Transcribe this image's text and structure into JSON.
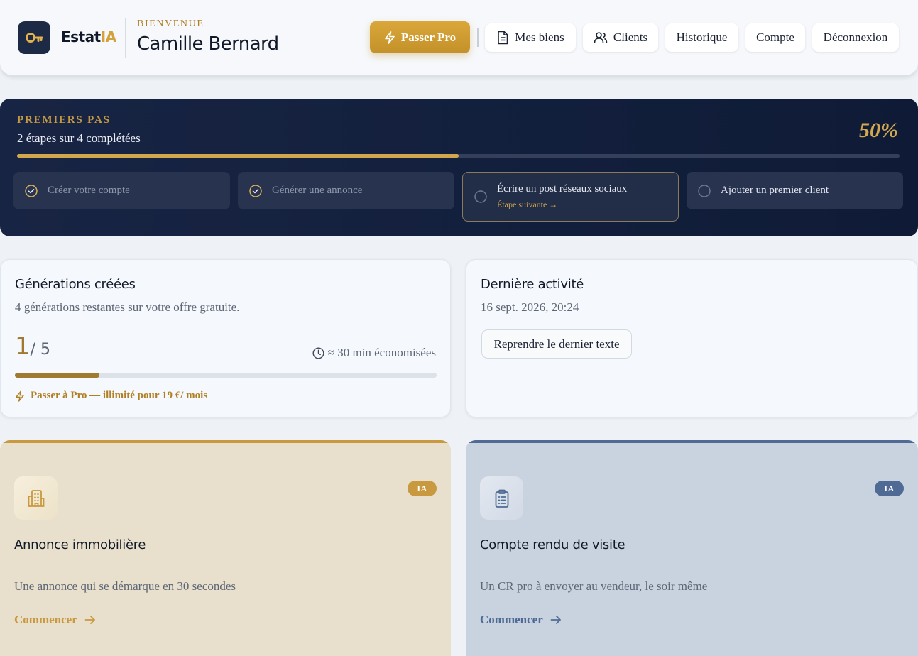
{
  "header": {
    "brand_main": "Estat",
    "brand_accent": "IA",
    "welcome": "BIENVENUE",
    "user_name": "Camille Bernard",
    "pro_button": "Passer Pro",
    "nav": [
      "Mes biens",
      "Clients",
      "Historique",
      "Compte",
      "Déconnexion"
    ]
  },
  "progress": {
    "title": "PREMIERS PAS",
    "subtitle": "2 étapes sur 4 complétées",
    "percent_label": "50%",
    "percent_value": 0.5,
    "steps": [
      {
        "label": "Créer votre compte",
        "done": true
      },
      {
        "label": "Générer une annonce",
        "done": true
      },
      {
        "label": "Écrire un post réseaux sociaux",
        "done": false,
        "next_label": "Étape suivante →"
      },
      {
        "label": "Ajouter un premier client",
        "done": false
      }
    ]
  },
  "generations": {
    "title": "Générations créées",
    "remaining_text": "4 générations restantes sur votre offre gratuite.",
    "used": "1",
    "total": "/ 5",
    "used_fraction": 0.2,
    "saved_text": "≈ 30 min économisées",
    "upsell": "Passer à Pro — illimité pour 19 €/ mois"
  },
  "activity": {
    "title": "Dernière activité",
    "date": "16 sept. 2026, 20:24",
    "resume_button": "Reprendre le dernier texte"
  },
  "features": [
    {
      "title": "Annonce immobilière",
      "description": "Une annonce qui se démarque en 30 secondes",
      "badge": "IA",
      "cta": "Commencer",
      "icon": "building-icon",
      "color": "#c8993f"
    },
    {
      "title": "Compte rendu de visite",
      "description": "Un CR pro à envoyer au vendeur, le soir même",
      "badge": "IA",
      "cta": "Commencer",
      "icon": "clipboard-icon",
      "color": "#4f6b95"
    }
  ],
  "colors": {
    "gold": "#c8993f",
    "navy": "#142040",
    "slate_blue": "#4f6b95",
    "background": "#eef2f6"
  }
}
